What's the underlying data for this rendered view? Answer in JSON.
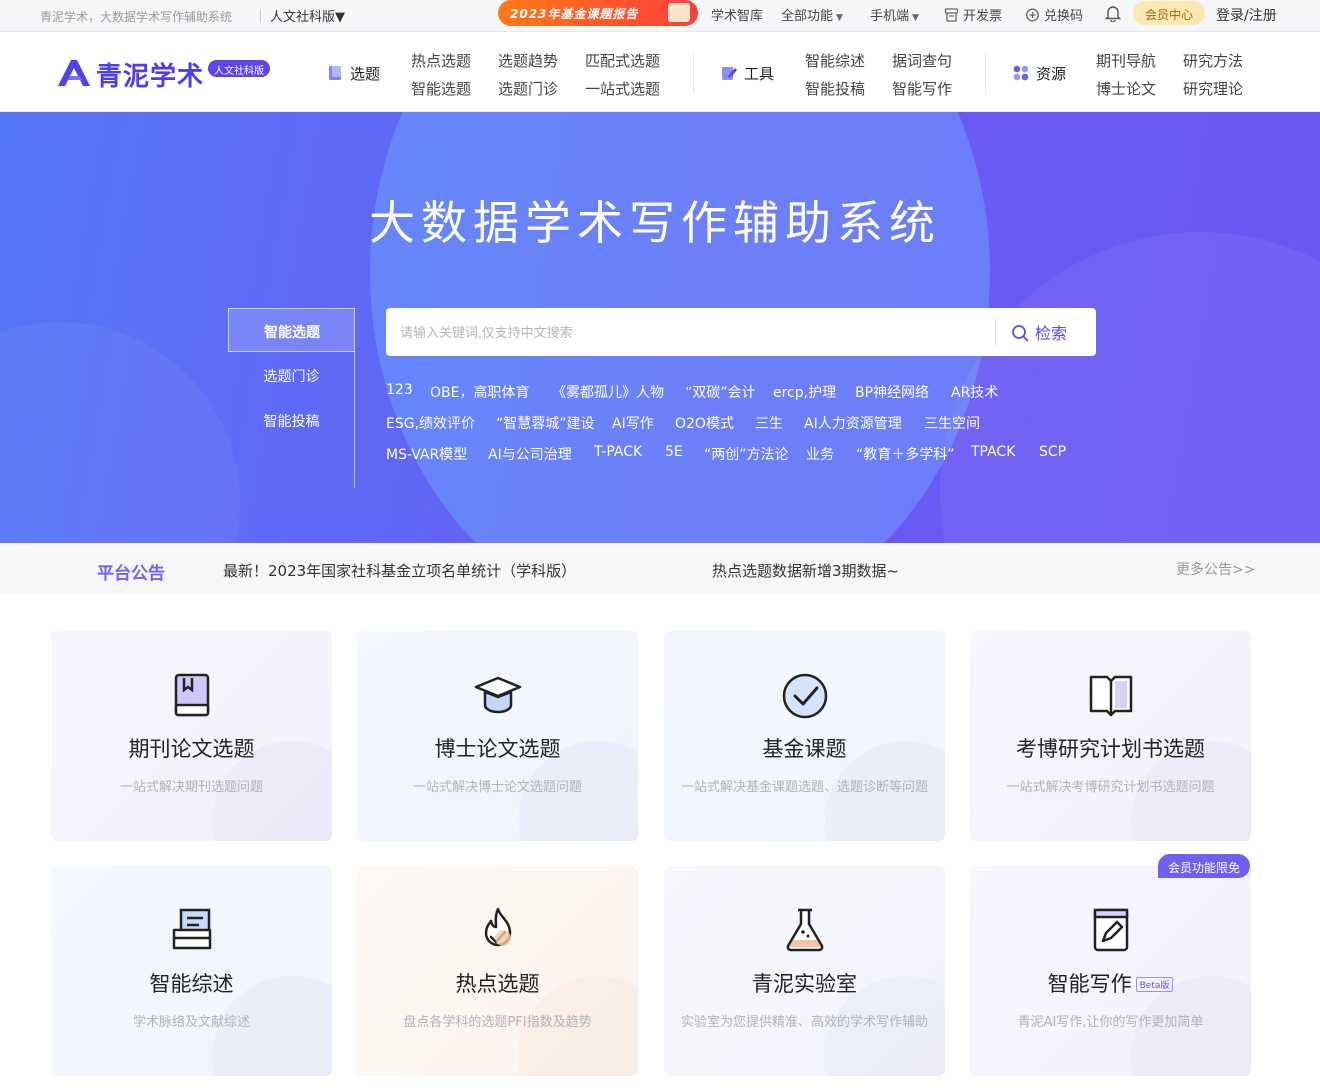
{
  "topbar": {
    "slogan": "青泥学术，大数据学术写作辅助系统",
    "edition": "人文社科版",
    "promo": "2023年基金课题报告",
    "links": [
      {
        "label": "学术智库",
        "caret": false
      },
      {
        "label": "全部功能",
        "caret": true
      },
      {
        "label": "手机端",
        "caret": true
      },
      {
        "label": "开发票",
        "caret": false
      },
      {
        "label": "兑换码",
        "caret": false
      }
    ],
    "vip": "会员中心",
    "login": "登录/注册"
  },
  "nav": {
    "logo_name": "青泥学术",
    "logo_tag": "人文社科版",
    "groups": [
      {
        "head": "选题",
        "links": [
          "热点选题",
          "选题趋势",
          "匹配式选题",
          "智能选题",
          "选题门诊",
          "一站式选题"
        ]
      },
      {
        "head": "工具",
        "links": [
          "智能综述",
          "据词查句",
          "智能投稿",
          "智能写作"
        ]
      },
      {
        "head": "资源",
        "links": [
          "期刊导航",
          "研究方法",
          "博士论文",
          "研究理论"
        ]
      }
    ]
  },
  "hero": {
    "title": "大数据学术写作辅助系统",
    "tabs": [
      "智能选题",
      "选题门诊",
      "智能投稿"
    ],
    "search_placeholder": "请输入关键词,仅支持中文搜索",
    "search_button": "检索",
    "keywords": [
      [
        "123",
        "OBE，高职体育",
        "《雾都孤儿》人物",
        "“双碳”会计",
        "ercp,护理",
        "BP神经网络",
        "AR技术"
      ],
      [
        "ESG,绩效评价",
        "“智慧蓉城”建设",
        "AI写作",
        "O2O模式",
        "三生",
        "AI人力资源管理",
        "三生空间"
      ],
      [
        "MS-VAR模型",
        "AI与公司治理",
        "T-PACK",
        "5E",
        "“两创”方法论",
        "业务",
        "“教育＋多学科”",
        "TPACK",
        "SCP"
      ]
    ]
  },
  "notice": {
    "label": "平台公告",
    "items": [
      "最新！2023年国家社科基金立项名单统计（学科版）",
      "热点选题数据新增3期数据~"
    ],
    "more": "更多公告>>"
  },
  "cards": [
    {
      "title": "期刊论文选题",
      "sub": "一站式解决期刊选题问题",
      "icon": "journal-book-icon"
    },
    {
      "title": "博士论文选题",
      "sub": "一站式解决博士论文选题问题",
      "icon": "graduation-cap-icon"
    },
    {
      "title": "基金课题",
      "sub": "一站式解决基金课题选题、选题诊断等问题",
      "icon": "check-circle-icon"
    },
    {
      "title": "考博研究计划书选题",
      "sub": "一站式解决考博研究计划书选题问题",
      "icon": "open-book-icon"
    },
    {
      "title": "智能综述",
      "sub": "学术脉络及文献综述",
      "icon": "document-tray-icon"
    },
    {
      "title": "热点选题",
      "sub": "盘点各学科的选题PFI指数及趋势",
      "icon": "flame-icon"
    },
    {
      "title": "青泥实验室",
      "sub": "实验室为您提供精准、高效的学术写作辅助",
      "icon": "flask-icon"
    },
    {
      "title": "智能写作",
      "sub": "青泥AI写作,让你的写作更加简单",
      "icon": "pen-note-icon",
      "badge": "Beta版"
    }
  ],
  "vip_badge": "会员功能限免",
  "colors": {
    "accent": "#5b46ee",
    "hero_start": "#5576f6",
    "hero_end": "#6b57f4",
    "vip_gold": "#fde7b2"
  }
}
